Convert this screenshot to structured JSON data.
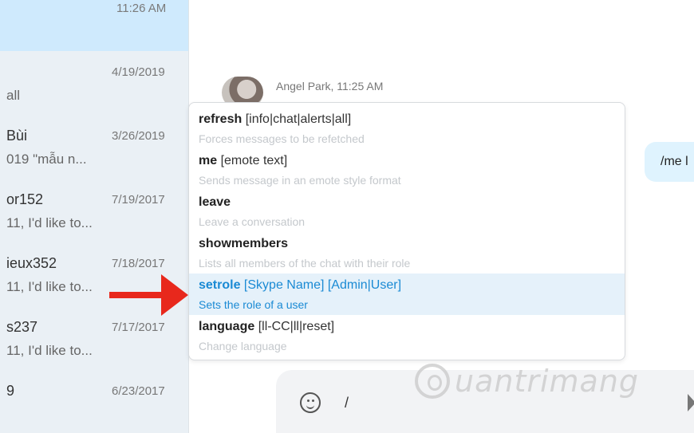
{
  "sidebar": {
    "top_time": "11:26 AM",
    "conversations": [
      {
        "name": "",
        "preview": "all",
        "date": "4/19/2019"
      },
      {
        "name": "Bùi",
        "preview": "019  \"mẫu n...",
        "date": "3/26/2019"
      },
      {
        "name": "or152",
        "preview": "11, I'd like to...",
        "date": "7/19/2017"
      },
      {
        "name": "ieux352",
        "preview": "11, I'd like to...",
        "date": "7/18/2017"
      },
      {
        "name": "s237",
        "preview": "11, I'd like to...",
        "date": "7/17/2017"
      },
      {
        "name": "9",
        "preview": "",
        "date": "6/23/2017"
      }
    ]
  },
  "chat": {
    "sender": "Angel Park, 11:25 AM",
    "my_message": "/me l",
    "compose_text": "/"
  },
  "commands": [
    {
      "name": "refresh",
      "args": "[info|chat|alerts|all]",
      "desc": "Forces messages to be refetched"
    },
    {
      "name": "me",
      "args": "[emote text]",
      "desc": "Sends message in an emote style format"
    },
    {
      "name": "leave",
      "args": "",
      "desc": "Leave a conversation"
    },
    {
      "name": "showmembers",
      "args": "",
      "desc": "Lists all members of the chat with their role"
    },
    {
      "name": "setrole",
      "args": "[Skype Name] [Admin|User]",
      "desc": "Sets the role of a user"
    },
    {
      "name": "language",
      "args": "[ll-CC|ll|reset]",
      "desc": "Change language"
    }
  ],
  "watermark": "uantrimang",
  "colors": {
    "accent": "#1a8ad4",
    "selected_bg": "#e5f1fa",
    "arrow": "#e8281c"
  }
}
